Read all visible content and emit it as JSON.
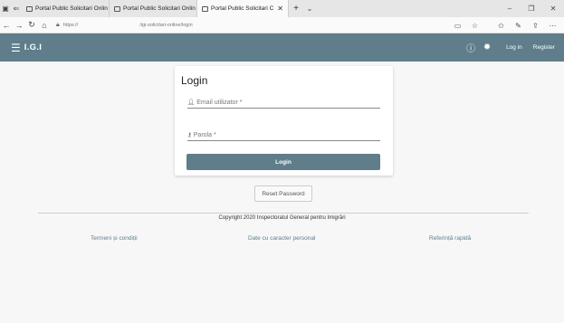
{
  "browser": {
    "tabs": [
      {
        "title": "Portal Public Solicitari Onlin"
      },
      {
        "title": "Portal Public Solicitari Onlin"
      },
      {
        "title": "Portal Public Solicitari C",
        "active": true
      }
    ],
    "address": {
      "scheme": "https://",
      "path": "/igi-solicitari-online/login"
    }
  },
  "appbar": {
    "brand": "I.G.I",
    "login_label": "Log in",
    "register_label": "Register",
    "color": "#5f7d8a"
  },
  "login_card": {
    "title": "Login",
    "email_placeholder": "Email utilizator *",
    "password_placeholder": "Parola *",
    "submit_label": "Login"
  },
  "reset_label": "Reset Password",
  "footer": {
    "copyright": "Copyright 2020 Inspectoratul General pentru Imigrări",
    "links": [
      "Termeni și condiții",
      "Date cu caracter personal",
      "Referință rapidă"
    ]
  }
}
